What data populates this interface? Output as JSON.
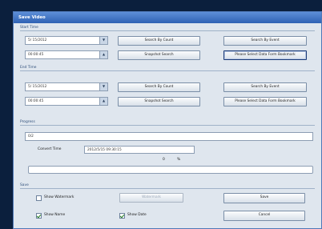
{
  "window": {
    "title": "Save Video"
  },
  "start_time": {
    "label": "Start Time",
    "date": "5/ 15/2012",
    "time": "00:00:45",
    "search_by_count": "Search By Count",
    "search_by_event": "Search By Event",
    "snapshot_search": "Snapshot Search",
    "bookmark": "Please Select Data Form Bookmark"
  },
  "end_time": {
    "label": "End Time",
    "date": "5/ 15/2012",
    "time": "00:00:45",
    "search_by_count": "Search By Count",
    "search_by_event": "Search By Event",
    "snapshot_search": "Snapshot Search",
    "bookmark": "Please Select Data Form Bookmark"
  },
  "progress": {
    "label": "Progress",
    "status_value": "0/2",
    "convert_time_label": "Convert Time",
    "convert_time_value": "2012/5/15 09:30:15",
    "percent_value": "0",
    "percent_sign": "%",
    "fraction": 0
  },
  "save": {
    "label": "Save",
    "show_watermark": "Show Watermark",
    "watermark_button": "Watermark",
    "save_button": "Save",
    "show_name": "Show Name",
    "show_date": "Show Date",
    "cancel_button": "Cancel",
    "show_watermark_checked": false,
    "show_name_checked": true,
    "show_date_checked": true
  },
  "colors": {
    "titlebar": "#2f62b4",
    "window_bg": "#dfe6ee",
    "desktop": "#0b1f3d"
  }
}
